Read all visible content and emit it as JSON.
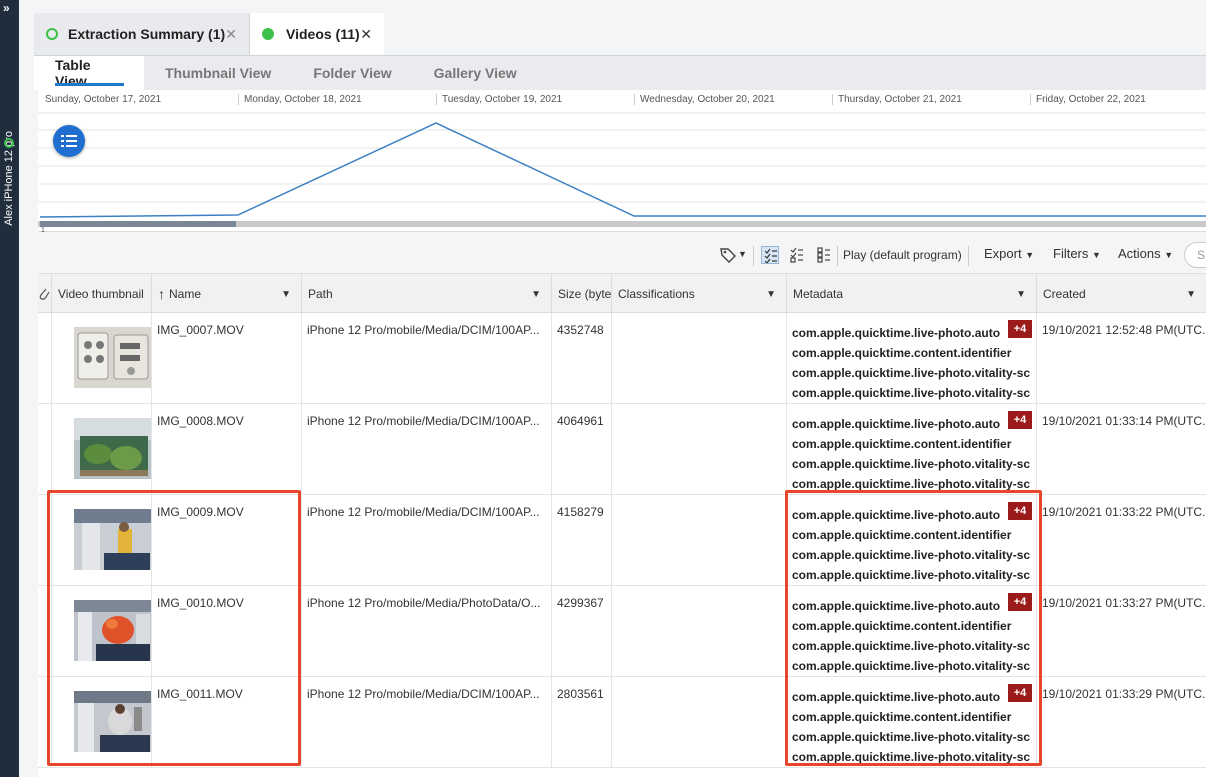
{
  "device": {
    "name": "Alex iPHone 12 pro"
  },
  "tabs": [
    {
      "label": "Extraction Summary (1)"
    },
    {
      "label": "Videos (11)"
    }
  ],
  "view_tabs": [
    {
      "label": "Table View"
    },
    {
      "label": "Thumbnail View"
    },
    {
      "label": "Folder View"
    },
    {
      "label": "Gallery View"
    }
  ],
  "timeline": {
    "dates": [
      "Sunday, October 17, 2021",
      "Monday, October 18, 2021",
      "Tuesday, October 19, 2021",
      "Wednesday, October 20, 2021",
      "Thursday, October 21, 2021",
      "Friday, October 22, 2021"
    ],
    "axis_label": "1",
    "line_color": "#3c7fc4"
  },
  "toolbar": {
    "play_label": "Play (default program)",
    "export_label": "Export",
    "filters_label": "Filters",
    "actions_label": "Actions",
    "search_placeholder": "S"
  },
  "columns": {
    "thumbnail": "Video thumbnail",
    "name": "Name",
    "path": "Path",
    "size": "Size (byte",
    "classifications": "Classifications",
    "metadata": "Metadata",
    "created": "Created"
  },
  "rows": [
    {
      "name": "IMG_0007.MOV",
      "path": "iPhone 12 Pro/mobile/Media/DCIM/100AP...",
      "size": "4352748",
      "meta": [
        "com.apple.quicktime.live-photo.auto",
        "com.apple.quicktime.content.identifier",
        "com.apple.quicktime.live-photo.vitality-sc",
        "com.apple.quicktime.live-photo.vitality-sc"
      ],
      "badge": "+4",
      "created": "19/10/2021 12:52:48 PM(UTC..."
    },
    {
      "name": "IMG_0008.MOV",
      "path": "iPhone 12 Pro/mobile/Media/DCIM/100AP...",
      "size": "4064961",
      "meta": [
        "com.apple.quicktime.live-photo.auto",
        "com.apple.quicktime.content.identifier",
        "com.apple.quicktime.live-photo.vitality-sc",
        "com.apple.quicktime.live-photo.vitality-sc"
      ],
      "badge": "+4",
      "created": "19/10/2021 01:33:14 PM(UTC..."
    },
    {
      "name": "IMG_0009.MOV",
      "path": "iPhone 12 Pro/mobile/Media/DCIM/100AP...",
      "size": "4158279",
      "meta": [
        "com.apple.quicktime.live-photo.auto",
        "com.apple.quicktime.content.identifier",
        "com.apple.quicktime.live-photo.vitality-sc",
        "com.apple.quicktime.live-photo.vitality-sc"
      ],
      "badge": "+4",
      "created": "19/10/2021 01:33:22 PM(UTC..."
    },
    {
      "name": "IMG_0010.MOV",
      "path": "iPhone 12 Pro/mobile/Media/PhotoData/O...",
      "size": "4299367",
      "meta": [
        "com.apple.quicktime.live-photo.auto",
        "com.apple.quicktime.content.identifier",
        "com.apple.quicktime.live-photo.vitality-sc",
        "com.apple.quicktime.live-photo.vitality-sc"
      ],
      "badge": "+4",
      "created": "19/10/2021 01:33:27 PM(UTC..."
    },
    {
      "name": "IMG_0011.MOV",
      "path": "iPhone 12 Pro/mobile/Media/DCIM/100AP...",
      "size": "2803561",
      "meta": [
        "com.apple.quicktime.live-photo.auto",
        "com.apple.quicktime.content.identifier",
        "com.apple.quicktime.live-photo.vitality-sc",
        "com.apple.quicktime.live-photo.vitality-sc"
      ],
      "badge": "+4",
      "created": "19/10/2021 01:33:29 PM(UTC..."
    }
  ],
  "colors": {
    "accent": "#1f78c8",
    "highlight": "#e8452a",
    "badge": "#9b1b1b",
    "status_green": "#3cc24a"
  }
}
